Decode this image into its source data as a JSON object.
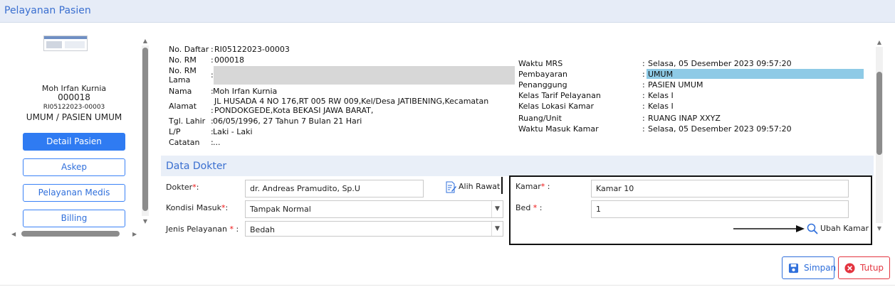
{
  "header": {
    "title": "Pelayanan Pasien"
  },
  "patient_card": {
    "name": "Moh Irfan Kurnia",
    "rm": "000018",
    "daftar": "RI05122023-00003",
    "payment": "UMUM / PASIEN UMUM"
  },
  "nav": [
    {
      "label": "Detail Pasien"
    },
    {
      "label": "Askep"
    },
    {
      "label": "Pelayanan Medis"
    },
    {
      "label": "Billing"
    }
  ],
  "info_left": [
    {
      "label": "No. Daftar",
      "value": "RI05122023-00003"
    },
    {
      "label": "No. RM",
      "value": "000018"
    },
    {
      "label": "No. RM",
      "label2": "Lama",
      "value": ""
    },
    {
      "label": "Nama",
      "value": "Moh Irfan Kurnia"
    },
    {
      "label": "Alamat",
      "value": "JL HUSADA 4 NO 176,RT 005 RW 009,Kel/Desa JATIBENING,Kecamatan",
      "value2": "PONDOKGEDE,Kota BEKASI JAWA BARAT,"
    },
    {
      "label": "Tgl. Lahir",
      "value": "06/05/1996, 27 Tahun 7 Bulan 21 Hari"
    },
    {
      "label": "L/P",
      "value": "Laki - Laki"
    },
    {
      "label": "Catatan",
      "value": "..."
    }
  ],
  "info_right": [
    {
      "label": "Waktu MRS",
      "value": "Selasa, 05 Desember 2023 09:57:20"
    },
    {
      "label": "Pembayaran",
      "value": "UMUM"
    },
    {
      "label": "Penanggung",
      "value": "PASIEN UMUM"
    },
    {
      "label": "Kelas Tarif Pelayanan",
      "value": "Kelas I"
    },
    {
      "label": "Kelas Lokasi Kamar",
      "value": "Kelas I"
    },
    {
      "label": "Ruang/Unit",
      "value": "RUANG INAP XXYZ"
    },
    {
      "label": "Waktu Masuk Kamar",
      "value": "Selasa, 05 Desember 2023 09:57:20"
    }
  ],
  "dokter_section": {
    "title": "Data Dokter",
    "dokter_label": "Dokter",
    "dokter_value": "dr. Andreas Pramudito, Sp.U",
    "alih_rawat": "Alih Rawat",
    "kondisi_label": "Kondisi Masuk",
    "kondisi_value": "Tampak Normal",
    "jenis_label": "Jenis Pelayanan",
    "jenis_value": "Bedah"
  },
  "kamar_section": {
    "kamar_label": "Kamar",
    "kamar_value": "Kamar 10",
    "bed_label": "Bed",
    "bed_value": "1",
    "ubah_kamar": "Ubah Kamar"
  },
  "common": {
    "colon": ":",
    "required": "*"
  },
  "footer": {
    "simpan": "Simpan",
    "tutup": "Tutup"
  },
  "colors": {
    "accent": "#2f7bf2",
    "danger": "#e3343f",
    "highlight": "#8ecae6"
  }
}
